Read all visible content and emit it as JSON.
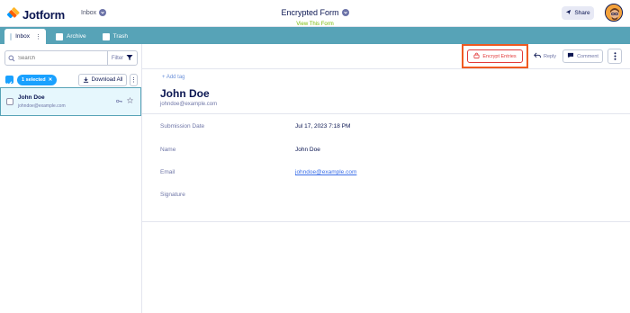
{
  "header": {
    "logo_text": "Jotform",
    "inbox_switch_label": "Inbox",
    "form_title": "Encrypted Form",
    "view_form_link": "View This Form",
    "share_label": "Share"
  },
  "tabs": [
    {
      "label": "Inbox",
      "active": true
    },
    {
      "label": "Archive",
      "active": false
    },
    {
      "label": "Trash",
      "active": false
    }
  ],
  "left_panel": {
    "search_placeholder": "Search",
    "filter_label": "Filter",
    "selected_label": "1 selected",
    "download_all_label": "Download All",
    "entries": [
      {
        "name": "John Doe",
        "email": "johndoe@example.com",
        "selected": true
      }
    ]
  },
  "toolbar": {
    "encrypt_label": "Encrypt Entries",
    "reply_label": "Reply",
    "comment_label": "Comment"
  },
  "submission": {
    "add_tag_label": "+ Add tag",
    "name": "John Doe",
    "email": "johndoe@example.com",
    "fields": [
      {
        "label": "Submission Date",
        "value": "Jul 17, 2023 7:18 PM",
        "is_link": false
      },
      {
        "label": "Name",
        "value": "John Doe",
        "is_link": false
      },
      {
        "label": "Email",
        "value": "johndoe@example.com",
        "is_link": true
      },
      {
        "label": "Signature",
        "value": "",
        "is_link": false
      }
    ]
  },
  "colors": {
    "tab_bar": "#57a3b7",
    "brand_orange": "#ff6100",
    "highlight_border": "#f05a22",
    "encrypt_red": "#e23a3a",
    "selected_blue": "#1aa1ff",
    "link_blue": "#3a6ee8",
    "navy_text": "#0a1551"
  },
  "icons": {
    "logo": "jotform-logo-icon",
    "search": "search-icon",
    "filter": "filter-icon",
    "download": "download-icon",
    "encrypt": "lock-icon",
    "reply": "reply-icon",
    "comment": "comment-icon",
    "more": "kebab-icon",
    "star": "star-icon"
  }
}
